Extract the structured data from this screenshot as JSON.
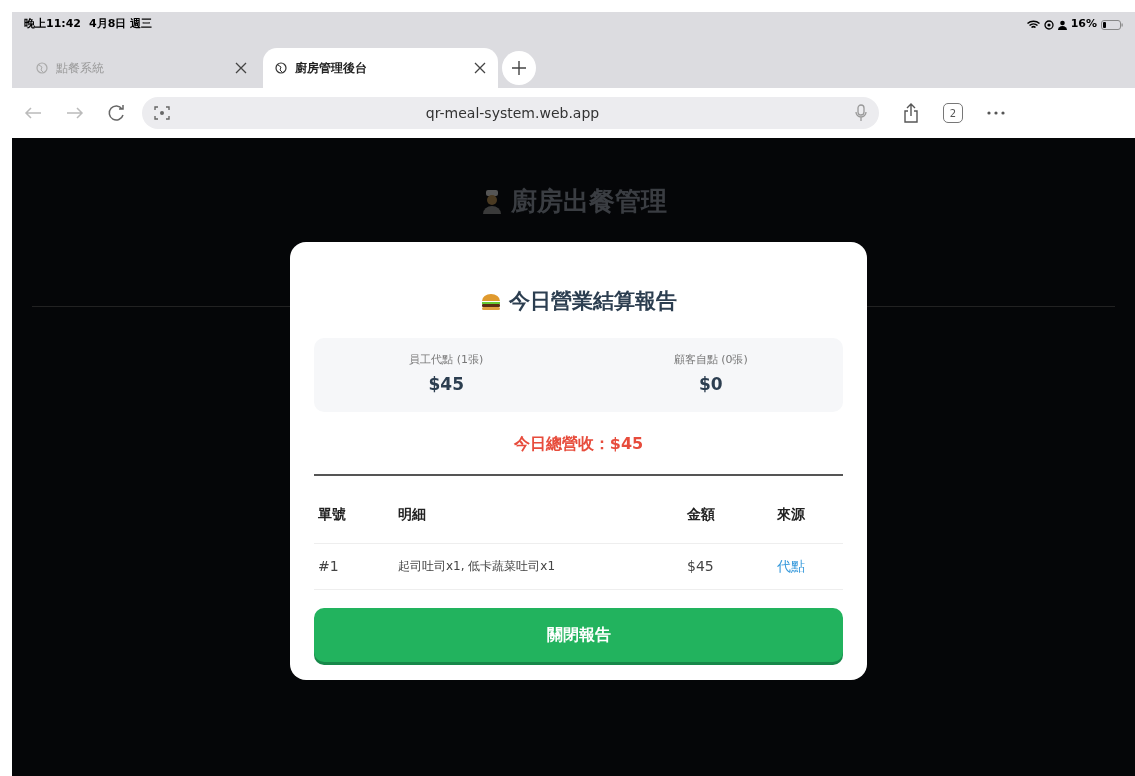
{
  "status_bar": {
    "time": "晚上11:42",
    "date": "4月8日 週三",
    "battery": "16%"
  },
  "tabs": [
    {
      "label": "點餐系統",
      "selected": false
    },
    {
      "label": "廚房管理後台",
      "selected": true
    }
  ],
  "address_bar": {
    "url": "qr-meal-system.web.app",
    "tab_count": "2"
  },
  "page": {
    "title": "廚房出餐管理"
  },
  "report": {
    "title": "今日營業結算報告",
    "summary": [
      {
        "label": "員工代點 (1張)",
        "amount": "$45"
      },
      {
        "label": "顧客自點 (0張)",
        "amount": "$0"
      }
    ],
    "total": "今日總營收：$45",
    "table": {
      "columns": [
        "單號",
        "明細",
        "金額",
        "來源"
      ],
      "rows": [
        {
          "id": "#1",
          "detail": "起司吐司x1, 低卡蔬菜吐司x1",
          "amount": "$45",
          "source": "代點"
        }
      ]
    },
    "close_button": "關閉報告"
  }
}
